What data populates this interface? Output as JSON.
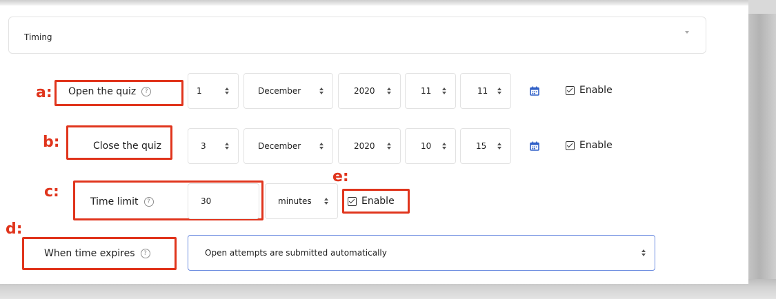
{
  "section": {
    "title": "Timing"
  },
  "markers": {
    "a": "a:",
    "b": "b:",
    "c": "c:",
    "d": "d:",
    "e": "e:"
  },
  "help_glyph": "?",
  "open_quiz": {
    "label": "Open the quiz",
    "day": "1",
    "month": "December",
    "year": "2020",
    "hour": "11",
    "minute": "11",
    "enable_label": "Enable",
    "enabled": true
  },
  "close_quiz": {
    "label": "Close the quiz",
    "day": "3",
    "month": "December",
    "year": "2020",
    "hour": "10",
    "minute": "15",
    "enable_label": "Enable",
    "enabled": true
  },
  "time_limit": {
    "label": "Time limit",
    "value": "30",
    "unit": "minutes",
    "enable_label": "Enable",
    "enabled": true
  },
  "time_expires": {
    "label": "When time expires",
    "value": "Open attempts are submitted automatically"
  },
  "colors": {
    "annotation": "#e0341c",
    "calendar": "#2f5fc7",
    "focus_border": "#6c8ce0"
  },
  "icons": {
    "calendar": "calendar-icon",
    "help": "help-icon",
    "select_arrows": "updown-arrows-icon",
    "collapse": "chevron-down-icon",
    "checkbox": "checkbox-checked-icon"
  }
}
